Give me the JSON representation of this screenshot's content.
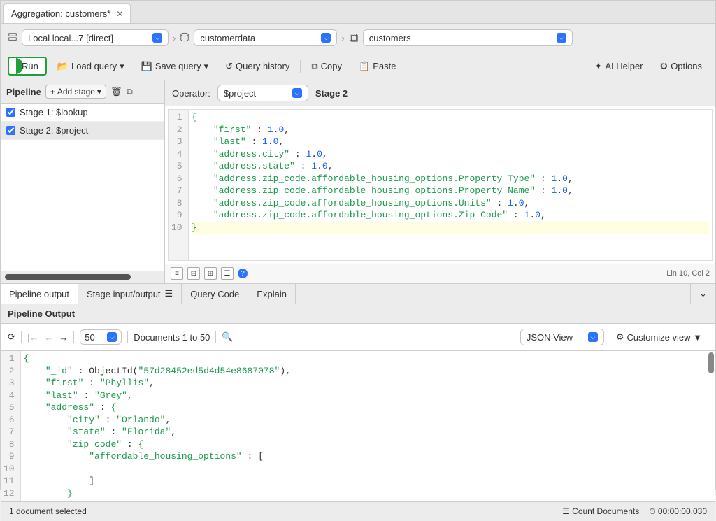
{
  "tab": {
    "title": "Aggregation: customers*"
  },
  "path": {
    "connection": "Local local...7 [direct]",
    "database": "customerdata",
    "collection": "customers"
  },
  "toolbar": {
    "run": "Run",
    "load_query": "Load query",
    "save_query": "Save query",
    "query_history": "Query history",
    "copy": "Copy",
    "paste": "Paste",
    "ai_helper": "AI Helper",
    "options": "Options"
  },
  "pipeline": {
    "title": "Pipeline",
    "add_stage": "Add stage",
    "stages": [
      {
        "label": "Stage 1: $lookup",
        "checked": true
      },
      {
        "label": "Stage 2: $project",
        "checked": true
      }
    ]
  },
  "editor": {
    "operator_label": "Operator:",
    "operator_value": "$project",
    "stage_label": "Stage 2",
    "cursor_pos": "Lin 10, Col 2",
    "code_lines": [
      {
        "n": 1,
        "tokens": [
          {
            "t": "brace",
            "v": "{"
          }
        ]
      },
      {
        "n": 2,
        "tokens": [
          {
            "t": "indent",
            "v": "    "
          },
          {
            "t": "key",
            "v": "\"first\""
          },
          {
            "t": "pun",
            "v": " : "
          },
          {
            "t": "num",
            "v": "1"
          },
          {
            "t": "pun",
            "v": "."
          },
          {
            "t": "num",
            "v": "0"
          },
          {
            "t": "pun",
            "v": ","
          }
        ]
      },
      {
        "n": 3,
        "tokens": [
          {
            "t": "indent",
            "v": "    "
          },
          {
            "t": "key",
            "v": "\"last\""
          },
          {
            "t": "pun",
            "v": " : "
          },
          {
            "t": "num",
            "v": "1"
          },
          {
            "t": "pun",
            "v": "."
          },
          {
            "t": "num",
            "v": "0"
          },
          {
            "t": "pun",
            "v": ","
          }
        ]
      },
      {
        "n": 4,
        "tokens": [
          {
            "t": "indent",
            "v": "    "
          },
          {
            "t": "key",
            "v": "\"address.city\""
          },
          {
            "t": "pun",
            "v": " : "
          },
          {
            "t": "num",
            "v": "1"
          },
          {
            "t": "pun",
            "v": "."
          },
          {
            "t": "num",
            "v": "0"
          },
          {
            "t": "pun",
            "v": ","
          }
        ]
      },
      {
        "n": 5,
        "tokens": [
          {
            "t": "indent",
            "v": "    "
          },
          {
            "t": "key",
            "v": "\"address.state\""
          },
          {
            "t": "pun",
            "v": " : "
          },
          {
            "t": "num",
            "v": "1"
          },
          {
            "t": "pun",
            "v": "."
          },
          {
            "t": "num",
            "v": "0"
          },
          {
            "t": "pun",
            "v": ","
          }
        ]
      },
      {
        "n": 6,
        "tokens": [
          {
            "t": "indent",
            "v": "    "
          },
          {
            "t": "key",
            "v": "\"address.zip_code.affordable_housing_options.Property Type\""
          },
          {
            "t": "pun",
            "v": " : "
          },
          {
            "t": "num",
            "v": "1"
          },
          {
            "t": "pun",
            "v": "."
          },
          {
            "t": "num",
            "v": "0"
          },
          {
            "t": "pun",
            "v": ","
          }
        ]
      },
      {
        "n": 7,
        "tokens": [
          {
            "t": "indent",
            "v": "    "
          },
          {
            "t": "key",
            "v": "\"address.zip_code.affordable_housing_options.Property Name\""
          },
          {
            "t": "pun",
            "v": " : "
          },
          {
            "t": "num",
            "v": "1"
          },
          {
            "t": "pun",
            "v": "."
          },
          {
            "t": "num",
            "v": "0"
          },
          {
            "t": "pun",
            "v": ","
          }
        ]
      },
      {
        "n": 8,
        "tokens": [
          {
            "t": "indent",
            "v": "    "
          },
          {
            "t": "key",
            "v": "\"address.zip_code.affordable_housing_options.Units\""
          },
          {
            "t": "pun",
            "v": " : "
          },
          {
            "t": "num",
            "v": "1"
          },
          {
            "t": "pun",
            "v": "."
          },
          {
            "t": "num",
            "v": "0"
          },
          {
            "t": "pun",
            "v": ","
          }
        ]
      },
      {
        "n": 9,
        "tokens": [
          {
            "t": "indent",
            "v": "    "
          },
          {
            "t": "key",
            "v": "\"address.zip_code.affordable_housing_options.Zip Code\""
          },
          {
            "t": "pun",
            "v": " : "
          },
          {
            "t": "num",
            "v": "1"
          },
          {
            "t": "pun",
            "v": "."
          },
          {
            "t": "num",
            "v": "0"
          },
          {
            "t": "pun",
            "v": ","
          }
        ]
      },
      {
        "n": 10,
        "hl": true,
        "tokens": [
          {
            "t": "brace",
            "v": "}"
          }
        ]
      }
    ]
  },
  "output_tabs": {
    "pipeline_output": "Pipeline output",
    "stage_io": "Stage input/output",
    "query_code": "Query Code",
    "explain": "Explain"
  },
  "output": {
    "title": "Pipeline Output",
    "page_size": "50",
    "doc_range": "Documents 1 to 50",
    "view_mode": "JSON View",
    "customize_view": "Customize view ▼",
    "code_lines": [
      {
        "n": 1,
        "tokens": [
          {
            "t": "brace",
            "v": "{"
          }
        ]
      },
      {
        "n": 2,
        "tokens": [
          {
            "t": "indent",
            "v": "    "
          },
          {
            "t": "key",
            "v": "\"_id\""
          },
          {
            "t": "pun",
            "v": " : "
          },
          {
            "t": "obj",
            "v": "ObjectId("
          },
          {
            "t": "str",
            "v": "\"57d28452ed5d4d54e8687078\""
          },
          {
            "t": "pun",
            "v": "),"
          }
        ]
      },
      {
        "n": 3,
        "tokens": [
          {
            "t": "indent",
            "v": "    "
          },
          {
            "t": "key",
            "v": "\"first\""
          },
          {
            "t": "pun",
            "v": " : "
          },
          {
            "t": "str",
            "v": "\"Phyllis\""
          },
          {
            "t": "pun",
            "v": ","
          }
        ]
      },
      {
        "n": 4,
        "tokens": [
          {
            "t": "indent",
            "v": "    "
          },
          {
            "t": "key",
            "v": "\"last\""
          },
          {
            "t": "pun",
            "v": " : "
          },
          {
            "t": "str",
            "v": "\"Grey\""
          },
          {
            "t": "pun",
            "v": ","
          }
        ]
      },
      {
        "n": 5,
        "tokens": [
          {
            "t": "indent",
            "v": "    "
          },
          {
            "t": "key",
            "v": "\"address\""
          },
          {
            "t": "pun",
            "v": " : "
          },
          {
            "t": "brace",
            "v": "{"
          }
        ]
      },
      {
        "n": 6,
        "tokens": [
          {
            "t": "indent",
            "v": "        "
          },
          {
            "t": "key",
            "v": "\"city\""
          },
          {
            "t": "pun",
            "v": " : "
          },
          {
            "t": "str",
            "v": "\"Orlando\""
          },
          {
            "t": "pun",
            "v": ","
          }
        ]
      },
      {
        "n": 7,
        "tokens": [
          {
            "t": "indent",
            "v": "        "
          },
          {
            "t": "key",
            "v": "\"state\""
          },
          {
            "t": "pun",
            "v": " : "
          },
          {
            "t": "str",
            "v": "\"Florida\""
          },
          {
            "t": "pun",
            "v": ","
          }
        ]
      },
      {
        "n": 8,
        "tokens": [
          {
            "t": "indent",
            "v": "        "
          },
          {
            "t": "key",
            "v": "\"zip_code\""
          },
          {
            "t": "pun",
            "v": " : "
          },
          {
            "t": "brace",
            "v": "{"
          }
        ]
      },
      {
        "n": 9,
        "tokens": [
          {
            "t": "indent",
            "v": "            "
          },
          {
            "t": "key",
            "v": "\"affordable_housing_options\""
          },
          {
            "t": "pun",
            "v": " : ["
          }
        ]
      },
      {
        "n": 10,
        "tokens": []
      },
      {
        "n": 11,
        "tokens": [
          {
            "t": "indent",
            "v": "            "
          },
          {
            "t": "pun",
            "v": "]"
          }
        ]
      },
      {
        "n": 12,
        "tokens": [
          {
            "t": "indent",
            "v": "        "
          },
          {
            "t": "brace",
            "v": "}"
          }
        ]
      }
    ]
  },
  "status": {
    "selection": "1 document selected",
    "count_documents": "Count Documents",
    "elapsed": "00:00:00.030"
  }
}
